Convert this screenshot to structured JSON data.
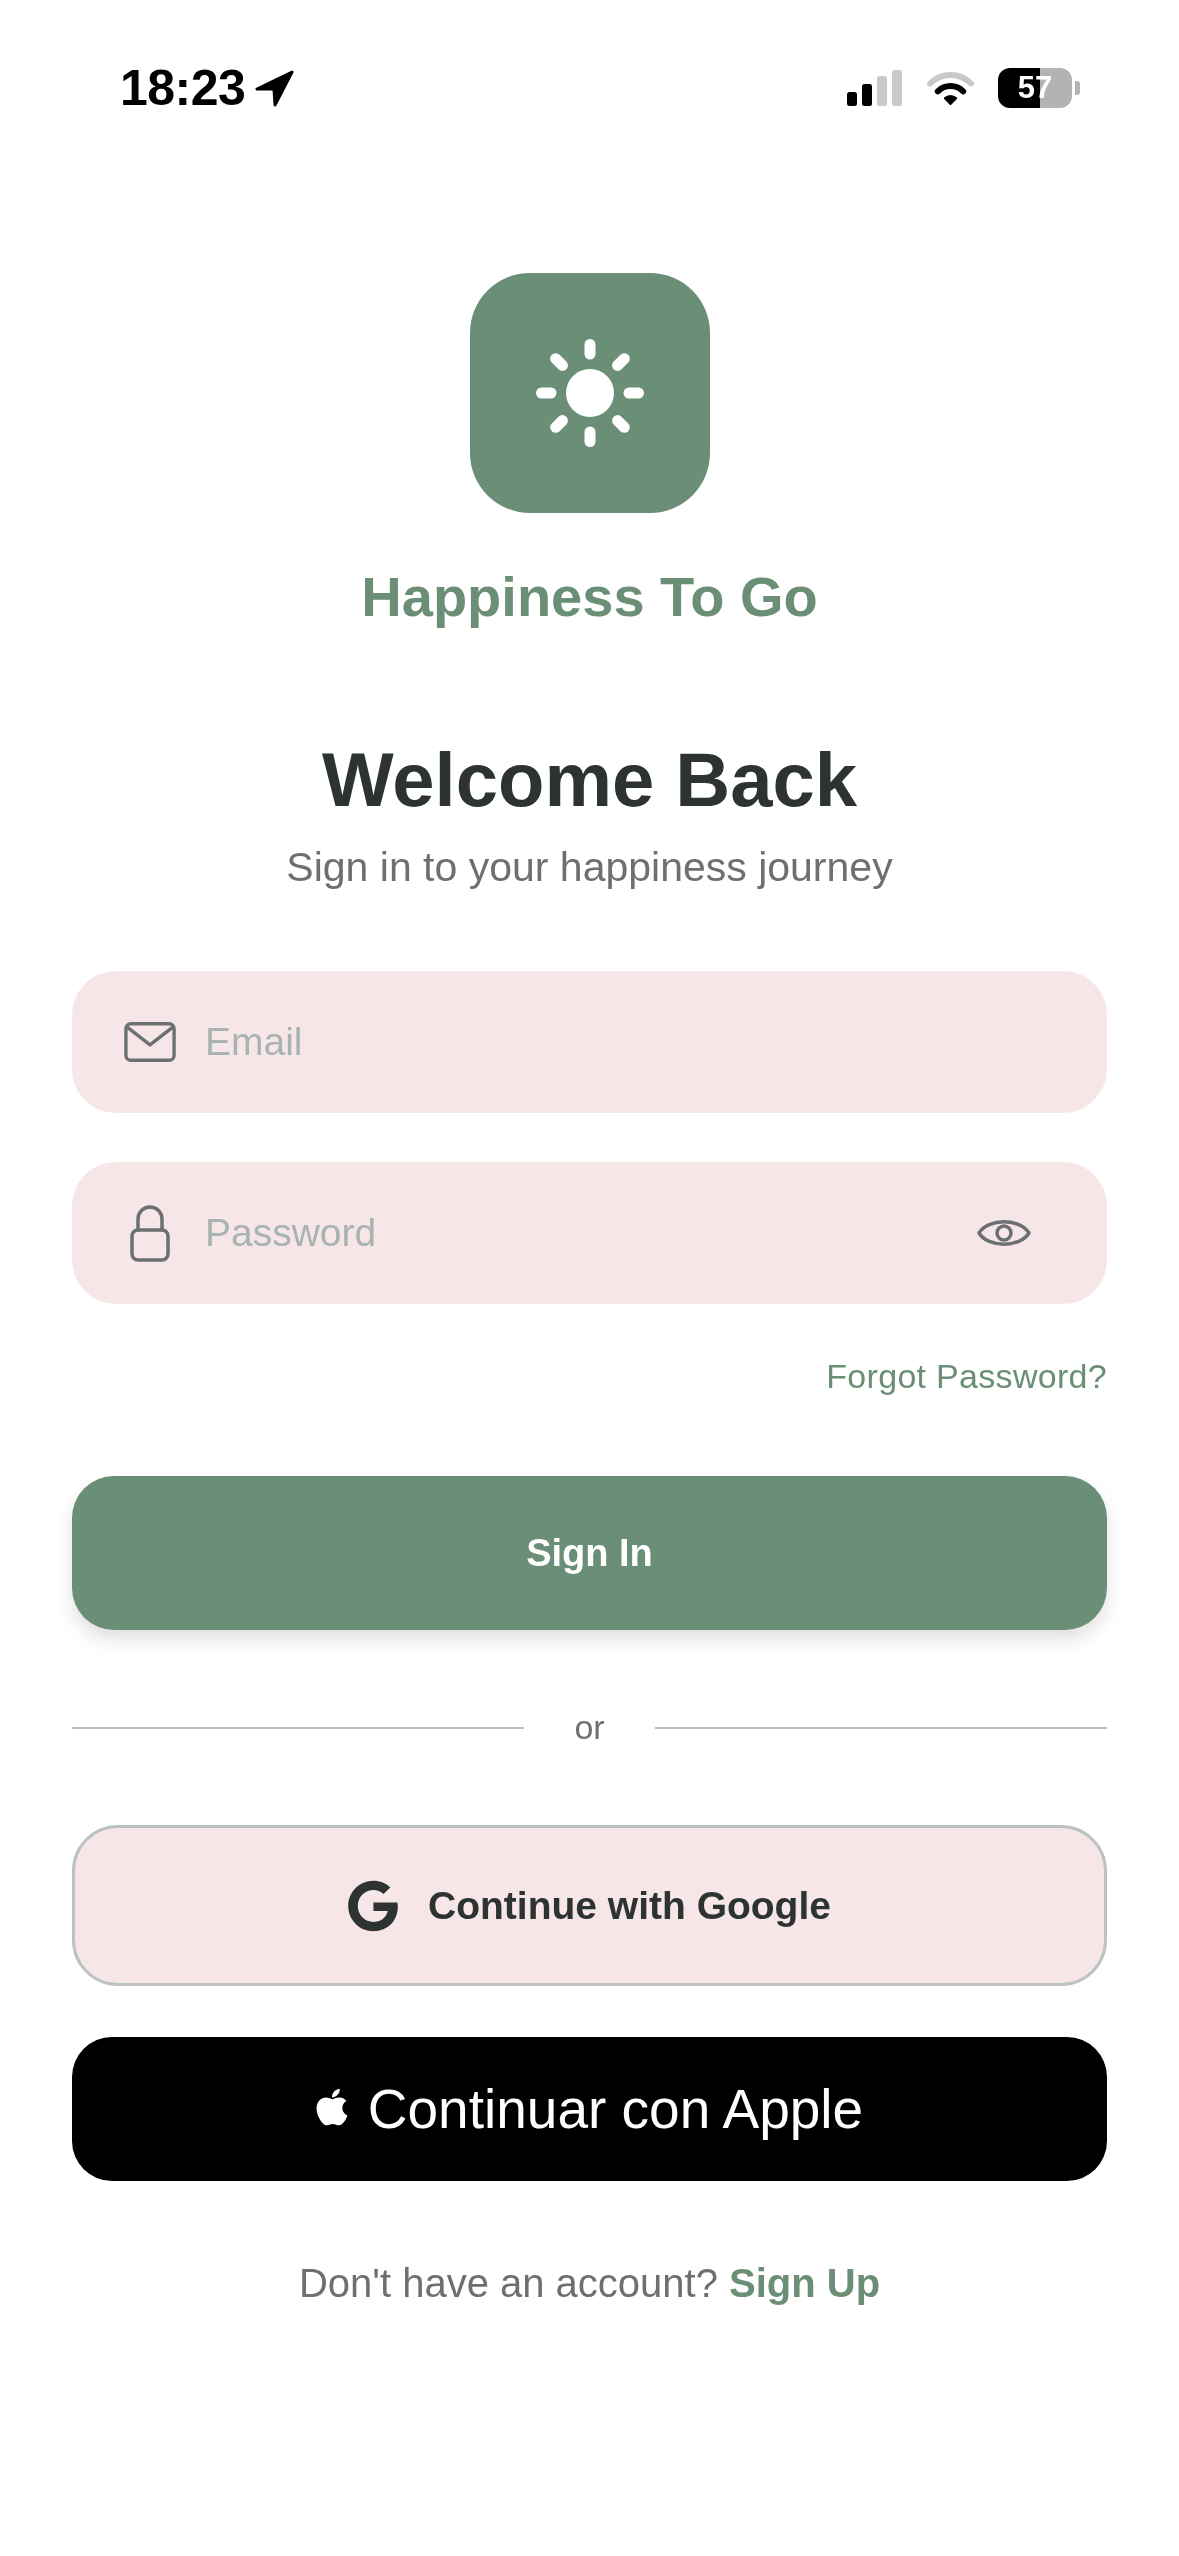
{
  "status_bar": {
    "time": "18:23",
    "battery": "57"
  },
  "app": {
    "name": "Happiness To Go"
  },
  "heading": {
    "title": "Welcome Back",
    "subtitle": "Sign in to your happiness journey"
  },
  "fields": [
    {
      "kind": "email",
      "placeholder": "Email"
    },
    {
      "kind": "password",
      "placeholder": "Password"
    }
  ],
  "forgot_password": "Forgot Password?",
  "sign_in_button": "Sign In",
  "divider": "or",
  "social_buttons": [
    {
      "kind": "google",
      "label": "Continue with Google"
    },
    {
      "kind": "apple",
      "label": "Continuar con Apple"
    }
  ],
  "footer": {
    "prompt": "Don't have an account?",
    "link": "Sign Up"
  }
}
